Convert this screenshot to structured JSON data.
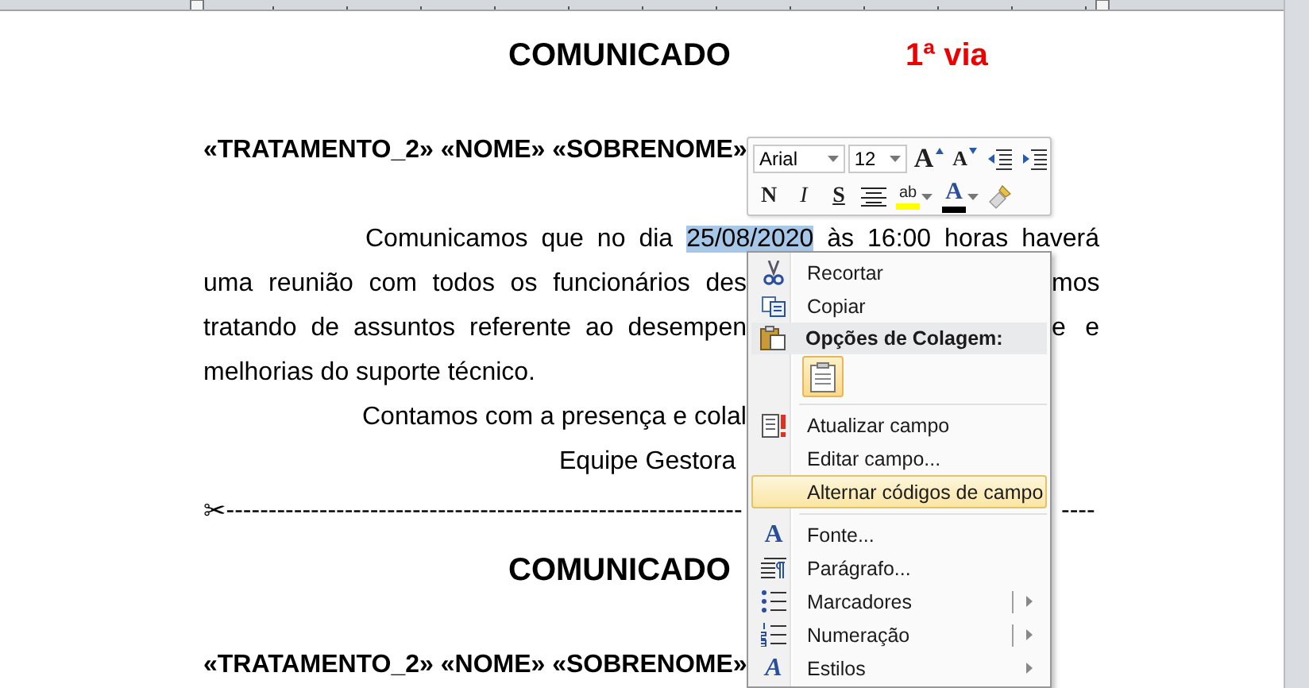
{
  "document": {
    "lines": [
      {
        "kind": "title",
        "text": "COMUNICADO",
        "copy_label": "1ª via"
      },
      {
        "kind": "salutation",
        "text": "«TRATAMENTO_2» «NOME» «SOBRENOME»"
      },
      {
        "kind": "selection_line",
        "before": "Comunicamos que no dia",
        "selection": "25/08/2020",
        "after": "às 16:00 horas haverá"
      },
      {
        "kind": "split_line",
        "left": "uma reunião com todos os funcionários des",
        "right": "mos"
      },
      {
        "kind": "split_line",
        "left": "tratando de assuntos referente ao desempen",
        "right": "e e"
      },
      {
        "kind": "line",
        "text": "melhorias do suporte técnico."
      },
      {
        "kind": "indented_line",
        "text": "Contamos com a presença e colal"
      },
      {
        "kind": "signature",
        "text": "Equipe Gestora"
      },
      {
        "kind": "cut_line",
        "scissors": "✂",
        "left": "-------------------------------------------------------------",
        "right": "----"
      },
      {
        "kind": "title",
        "text": "COMUNICADO"
      },
      {
        "kind": "salutation",
        "text": "«TRATAMENTO_2» «NOME» «SOBRENOME»"
      }
    ]
  },
  "mini_toolbar": {
    "font": "Arial",
    "size": "12",
    "row_1": [
      {
        "kind": "grow_font",
        "glyph": "A"
      },
      {
        "kind": "shrink_font",
        "glyph": "A"
      },
      {
        "kind": "decrease_indent"
      },
      {
        "kind": "increase_indent"
      }
    ],
    "row_2": [
      {
        "kind": "bold",
        "glyph": "N"
      },
      {
        "kind": "italic",
        "glyph": "I"
      },
      {
        "kind": "underline",
        "glyph": "S"
      },
      {
        "kind": "center"
      },
      {
        "kind": "highlight",
        "glyph": "ab",
        "color": "#ffff00"
      },
      {
        "kind": "font_color",
        "glyph": "A",
        "color": "#000000"
      },
      {
        "kind": "format_painter"
      }
    ]
  },
  "menu": {
    "items": [
      {
        "kind": "item",
        "label": "Recortar",
        "selected": false
      },
      {
        "kind": "item",
        "label": "Copiar",
        "selected": false
      },
      {
        "kind": "header",
        "label": "Opções de Colagem:"
      },
      {
        "kind": "paste_options"
      },
      {
        "kind": "separator"
      },
      {
        "kind": "item",
        "label": "Atualizar campo",
        "selected": false
      },
      {
        "kind": "item",
        "label": "Editar campo...",
        "selected": false
      },
      {
        "kind": "item",
        "label": "Alternar códigos de campo",
        "selected": true
      },
      {
        "kind": "separator"
      },
      {
        "kind": "item",
        "label": "Fonte...",
        "selected": false,
        "icon_glyph": "A"
      },
      {
        "kind": "item",
        "label": "Parágrafo...",
        "selected": false
      },
      {
        "kind": "item",
        "label": "Marcadores",
        "selected": false,
        "submenu": true,
        "split": true
      },
      {
        "kind": "item",
        "label": "Numeração",
        "selected": false,
        "submenu": true,
        "split": true
      },
      {
        "kind": "item",
        "label": "Estilos",
        "selected": false,
        "submenu": true,
        "icon_glyph": "A"
      }
    ]
  }
}
